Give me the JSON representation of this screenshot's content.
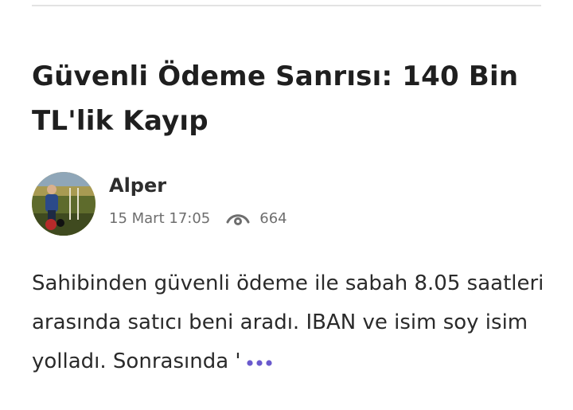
{
  "article": {
    "title": "Güvenli Ödeme Sanrısı: 140 Bin TL'lik Kayıp",
    "author": {
      "name": "Alper",
      "avatar_icon": "user-photo"
    },
    "date": "15 Mart 17:05",
    "views": "664",
    "views_icon": "eye-icon",
    "excerpt": "Sahibinden güvenli ödeme ile sabah 8.05 saatleri arasında satıcı beni aradı. IBAN ve isim soy isim yolladı. Sonrasında '",
    "more_icon": "more-dots-icon"
  },
  "colors": {
    "accent": "#6a5acd",
    "text": "#2a2a2a",
    "meta": "#6e6e6e",
    "divider": "#e3e3e3"
  }
}
